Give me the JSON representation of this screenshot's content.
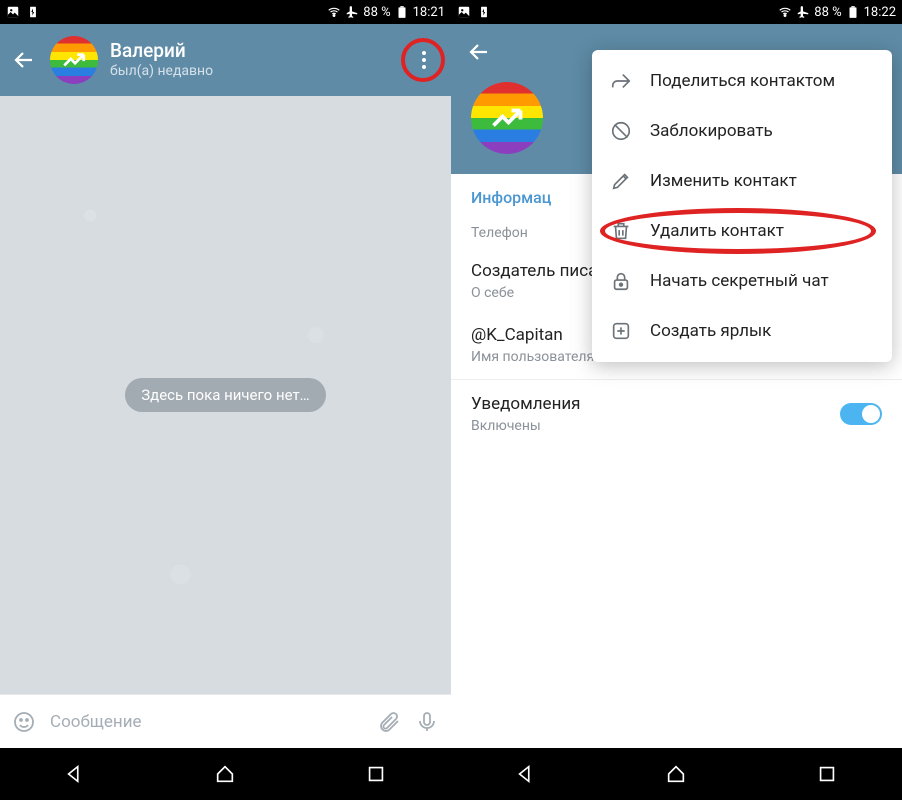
{
  "status": {
    "battery_pct": "88 %",
    "time_left": "18:21",
    "time_right": "18:22"
  },
  "left": {
    "contact_name": "Валерий",
    "contact_status": "был(а) недавно",
    "empty_text": "Здесь пока ничего нет…",
    "input_placeholder": "Сообщение"
  },
  "right": {
    "info_label": "Информац",
    "phone_label": "Телефон",
    "bio_value": "Создатель писать Ма",
    "bio_label": "О себе",
    "username_value": "@K_Capitan",
    "username_label": "Имя пользователя",
    "notif_title": "Уведомления",
    "notif_value": "Включены"
  },
  "menu": {
    "share": "Поделиться контактом",
    "block": "Заблокировать",
    "edit": "Изменить контакт",
    "delete": "Удалить контакт",
    "secret": "Начать секретный чат",
    "shortcut": "Создать ярлык"
  }
}
